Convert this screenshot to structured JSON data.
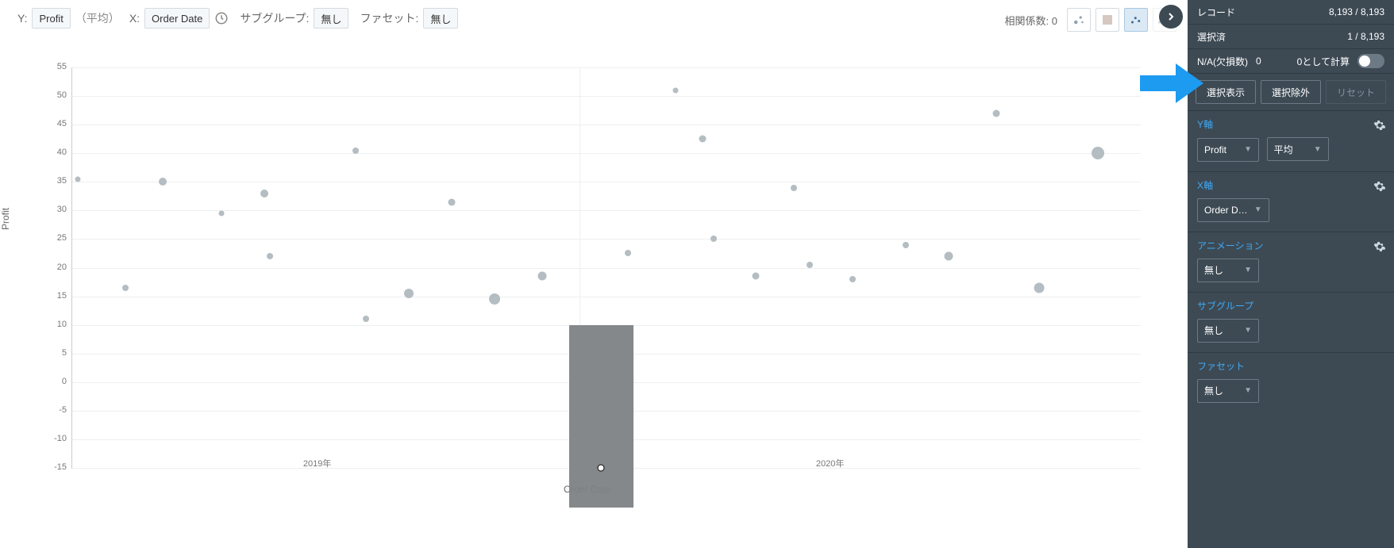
{
  "top": {
    "y_prefix": "Y:",
    "y_value": "Profit",
    "y_agg": "（平均）",
    "x_prefix": "X:",
    "x_value": "Order Date",
    "subgroup_label": "サブグループ:",
    "subgroup_value": "無し",
    "facet_label": "ファセット:",
    "facet_value": "無し",
    "corr_label": "相関係数: 0"
  },
  "chart": {
    "y_title": "Profit",
    "x_title": "Order Date",
    "x_ticks": [
      "2019年",
      "2020年"
    ]
  },
  "sidebar": {
    "records_label": "レコード",
    "records_value": "8,193 / 8,193",
    "selected_label": "選択済",
    "selected_value": "1 / 8,193",
    "na_label": "N/A(欠損数)",
    "na_count": "0",
    "na_zero_label": "0として計算",
    "btn_show": "選択表示",
    "btn_exclude": "選択除外",
    "btn_reset": "リセット",
    "y_section": "Y軸",
    "y_var": "Profit",
    "y_agg": "平均",
    "x_section": "X軸",
    "x_var": "Order D…",
    "anim_section": "アニメーション",
    "anim_value": "無し",
    "subgroup_section": "サブグループ",
    "subgroup_value": "無し",
    "facet_section": "ファセット",
    "facet_value": "無し"
  },
  "chart_data": {
    "type": "scatter",
    "xlabel": "Order Date",
    "ylabel": "Profit",
    "ylim": [
      -15,
      55
    ],
    "x_range_labels": [
      "2019年",
      "2020年"
    ],
    "selection_value": -15,
    "series": [
      {
        "name": "Profit (平均)",
        "points": [
          {
            "xi": 0.005,
            "y": 35.5,
            "size": 7
          },
          {
            "xi": 0.05,
            "y": 16.5,
            "size": 8
          },
          {
            "xi": 0.085,
            "y": 35.0,
            "size": 10
          },
          {
            "xi": 0.14,
            "y": 29.5,
            "size": 7
          },
          {
            "xi": 0.18,
            "y": 33.0,
            "size": 10
          },
          {
            "xi": 0.185,
            "y": 22.0,
            "size": 8
          },
          {
            "xi": 0.265,
            "y": 40.5,
            "size": 8
          },
          {
            "xi": 0.275,
            "y": 11.0,
            "size": 8
          },
          {
            "xi": 0.315,
            "y": 15.5,
            "size": 12
          },
          {
            "xi": 0.355,
            "y": 31.5,
            "size": 9
          },
          {
            "xi": 0.395,
            "y": 14.5,
            "size": 14
          },
          {
            "xi": 0.44,
            "y": 18.5,
            "size": 11
          },
          {
            "xi": 0.52,
            "y": 22.5,
            "size": 8
          },
          {
            "xi": 0.565,
            "y": 51.0,
            "size": 7
          },
          {
            "xi": 0.59,
            "y": 42.5,
            "size": 9
          },
          {
            "xi": 0.6,
            "y": 25.0,
            "size": 8
          },
          {
            "xi": 0.64,
            "y": 18.5,
            "size": 9
          },
          {
            "xi": 0.675,
            "y": 34.0,
            "size": 8
          },
          {
            "xi": 0.69,
            "y": 20.5,
            "size": 8
          },
          {
            "xi": 0.73,
            "y": 18.0,
            "size": 8
          },
          {
            "xi": 0.78,
            "y": 24.0,
            "size": 8
          },
          {
            "xi": 0.82,
            "y": 22.0,
            "size": 11
          },
          {
            "xi": 0.865,
            "y": 47.0,
            "size": 9
          },
          {
            "xi": 0.905,
            "y": 16.5,
            "size": 13
          },
          {
            "xi": 0.96,
            "y": 40.0,
            "size": 16
          }
        ]
      }
    ]
  }
}
